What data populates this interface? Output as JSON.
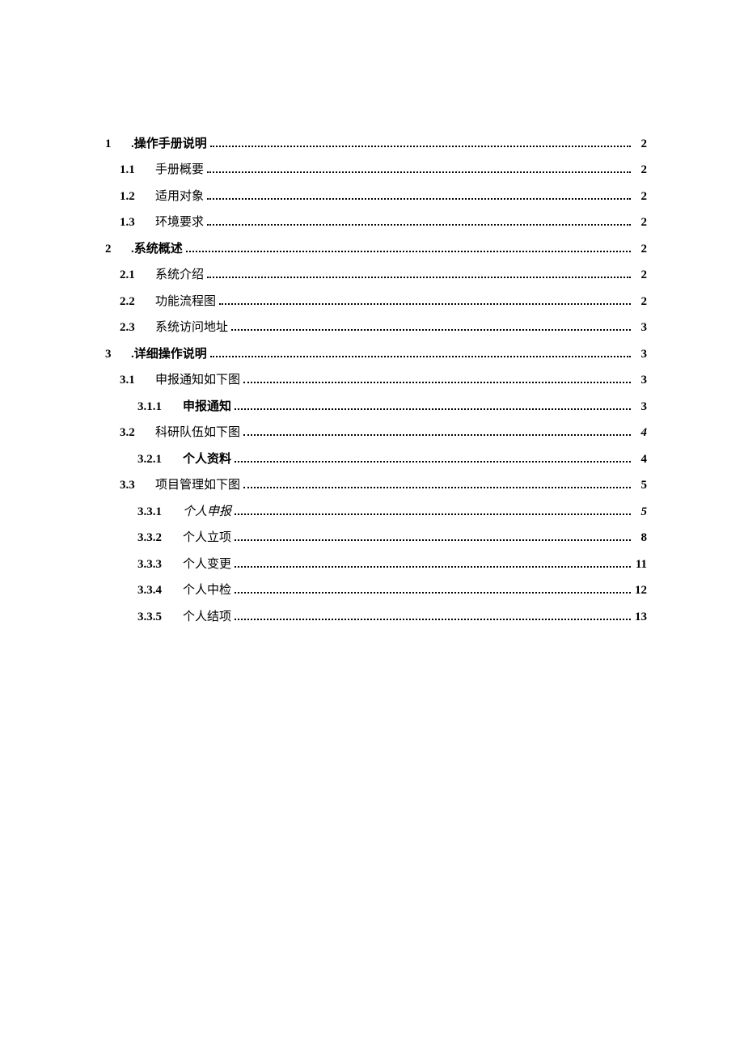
{
  "toc": [
    {
      "level": 1,
      "num": "1",
      "title": ".操作手册说明",
      "page": "2",
      "bold_title": true
    },
    {
      "level": 2,
      "num": "1.1",
      "title": "手册概要",
      "page": "2"
    },
    {
      "level": 2,
      "num": "1.2",
      "title": "适用对象",
      "page": "2"
    },
    {
      "level": 2,
      "num": "1.3",
      "title": "环境要求",
      "page": "2"
    },
    {
      "level": 1,
      "num": "2",
      "title": ".系统概述",
      "page": "2",
      "bold_title": true
    },
    {
      "level": 2,
      "num": "2.1",
      "title": "系统介绍",
      "page": "2"
    },
    {
      "level": 2,
      "num": "2.2",
      "title": "功能流程图",
      "page": "2"
    },
    {
      "level": 2,
      "num": "2.3",
      "title": "系统访问地址",
      "page": "3"
    },
    {
      "level": 1,
      "num": "3",
      "title": ".详细操作说明",
      "page": "3",
      "bold_title": true
    },
    {
      "level": 2,
      "num": "3.1",
      "title": "申报通知如下图",
      "page": "3"
    },
    {
      "level": 3,
      "num": "3.1.1",
      "title": "申报通知",
      "page": "3",
      "bold_title": true
    },
    {
      "level": 2,
      "num": "3.2",
      "title": "科研队伍如下图",
      "page": "4",
      "italic_page": true
    },
    {
      "level": 3,
      "num": "3.2.1",
      "title": "个人资料",
      "page": "4",
      "bold_title": true
    },
    {
      "level": 2,
      "num": "3.3",
      "title": "项目管理如下图",
      "page": "5"
    },
    {
      "level": 3,
      "num": "3.3.1",
      "title": "个人申报",
      "page": "5",
      "italic_title": true,
      "italic_page": true
    },
    {
      "level": 3,
      "num": "3.3.2",
      "title": "个人立项",
      "page": "8"
    },
    {
      "level": 3,
      "num": "3.3.3",
      "title": "个人变更",
      "page": "11"
    },
    {
      "level": 3,
      "num": "3.3.4",
      "title": "个人中检",
      "page": "12"
    },
    {
      "level": 3,
      "num": "3.3.5",
      "title": "个人结项",
      "page": "13"
    }
  ]
}
